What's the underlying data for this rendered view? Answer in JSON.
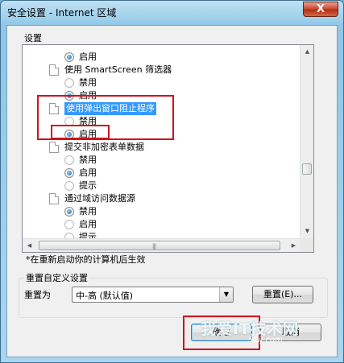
{
  "window": {
    "title": "安全设置 - Internet 区域",
    "close_glyph": "X"
  },
  "settings_group": {
    "label": "设置"
  },
  "list_rows": [
    {
      "type": "radio",
      "label": "启用",
      "checked": true
    },
    {
      "type": "category",
      "label": "使用 SmartScreen 筛选器"
    },
    {
      "type": "radio",
      "label": "禁用",
      "checked": false
    },
    {
      "type": "radio",
      "label": "启用",
      "checked": true
    },
    {
      "type": "category",
      "label": "使用弹出窗口阻止程序",
      "selected": true
    },
    {
      "type": "radio",
      "label": "禁用",
      "checked": false
    },
    {
      "type": "radio",
      "label": "启用",
      "checked": true
    },
    {
      "type": "category",
      "label": "提交非加密表单数据"
    },
    {
      "type": "radio",
      "label": "禁用",
      "checked": false
    },
    {
      "type": "radio",
      "label": "启用",
      "checked": true
    },
    {
      "type": "radio",
      "label": "提示",
      "checked": false
    },
    {
      "type": "category",
      "label": "通过域访问数据源"
    },
    {
      "type": "radio",
      "label": "禁用",
      "checked": true
    },
    {
      "type": "radio",
      "label": "启用",
      "checked": false
    },
    {
      "type": "radio",
      "label": "提示",
      "checked": false
    }
  ],
  "restart_note": "*在重新启动你的计算机后生效",
  "reset_group": {
    "label": "重置自定义设置",
    "reset_to_label": "重置为",
    "selected_level": "中-高 (默认值)",
    "reset_button": "重置(E)..."
  },
  "buttons": {
    "ok": "确定",
    "cancel": "取消"
  },
  "watermark": {
    "text": "我爱IT技术网",
    "sub": "52ij.com"
  }
}
